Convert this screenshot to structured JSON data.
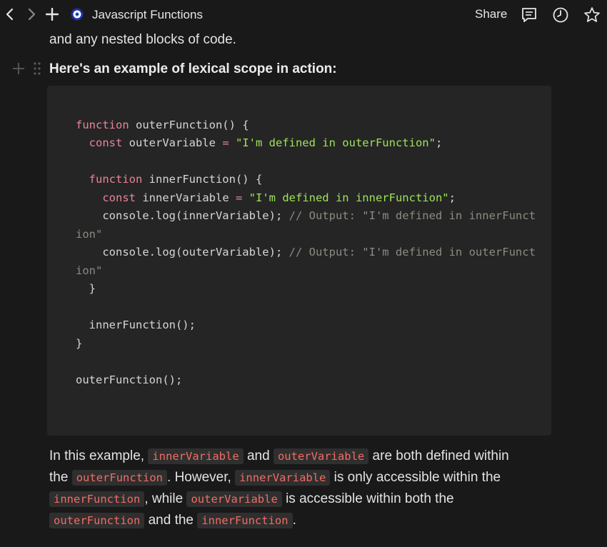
{
  "topbar": {
    "title": "Javascript Functions",
    "share_label": "Share"
  },
  "content": {
    "prev_line": "and any nested blocks of code.",
    "heading": "Here's an example of lexical scope in action:"
  },
  "code": {
    "l1_kw": "function",
    "l1_rest": " outerFunction() {",
    "l2_kw": "  const",
    "l2_name": " outerVariable ",
    "l2_op": "=",
    "l2_str": " \"I'm defined in outerFunction\"",
    "l2_end": ";",
    "l4_kw": "  function",
    "l4_rest": " innerFunction() {",
    "l5_kw": "    const",
    "l5_name": " innerVariable ",
    "l5_op": "=",
    "l5_str": " \"I'm defined in innerFunction\"",
    "l5_end": ";",
    "l6_code": "    console.log(innerVariable); ",
    "l6_cm": "// Output: \"I'm defined in innerFunct",
    "l7_cm": "ion\"",
    "l8_code": "    console.log(outerVariable); ",
    "l8_cm": "// Output: \"I'm defined in outerFunct",
    "l9_cm": "ion\"",
    "l10": "  }",
    "l12": "  innerFunction();",
    "l13": "}",
    "l15": "outerFunction();"
  },
  "paragraph": {
    "p1_a": "In this example, ",
    "p1_code1": "innerVariable",
    "p1_b": " and ",
    "p1_code2": "outerVariable",
    "p1_c": " are both defined within",
    "p2_a": "the ",
    "p2_code1": "outerFunction",
    "p2_b": ". However, ",
    "p2_code2": "innerVariable",
    "p2_c": " is only accessible within the",
    "p3_code1": "innerFunction",
    "p3_b": ", while ",
    "p3_code2": "outerVariable",
    "p3_c": " is accessible within both the",
    "p4_code1": "outerFunction",
    "p4_b": " and the ",
    "p4_code2": "innerFunction",
    "p4_c": "."
  },
  "icons": {
    "back": "chevron-left-icon",
    "forward": "chevron-right-icon",
    "new": "plus-icon",
    "page": "page-emoji-icon",
    "comments": "comment-icon",
    "history": "clock-icon",
    "favorite": "star-icon",
    "add_block": "plus-icon",
    "drag": "drag-handle-icon"
  },
  "colors": {
    "background": "#191919",
    "code_background": "#252525",
    "keyword": "#e8849a",
    "string": "#9fe35a",
    "comment": "#8d8a82",
    "inline_code": "#f26c63"
  }
}
